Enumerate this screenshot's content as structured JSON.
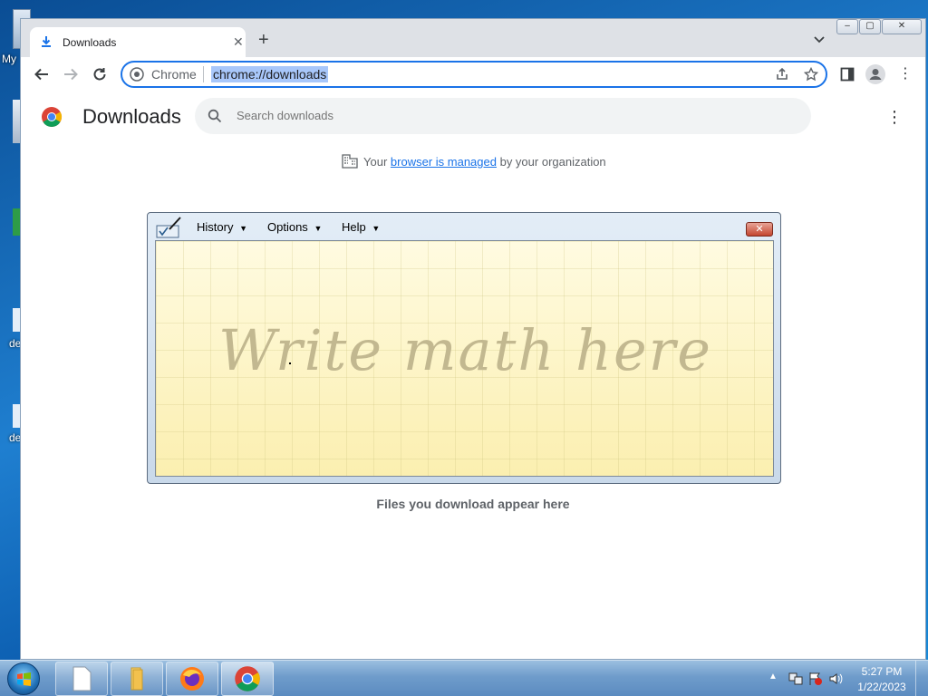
{
  "desktop": {
    "labels": [
      "My",
      "de",
      "de"
    ]
  },
  "browser": {
    "tab": {
      "title": "Downloads"
    },
    "new_tab_label": "+",
    "window_controls": [
      "–",
      "▢",
      "✕"
    ],
    "omnibox": {
      "chip": "Chrome",
      "url": "chrome://downloads"
    }
  },
  "downloads_page": {
    "title": "Downloads",
    "search_placeholder": "Search downloads",
    "managed_prefix": "Your",
    "managed_link": "browser is managed",
    "managed_suffix": "by your organization",
    "empty_message": "Files you download appear here"
  },
  "math_input_panel": {
    "menus": [
      {
        "label": "History"
      },
      {
        "label": "Options"
      },
      {
        "label": "Help"
      }
    ],
    "close_label": "✕",
    "hint": "Write math here"
  },
  "taskbar": {
    "time": "5:27 PM",
    "date": "1/22/2023"
  },
  "colors": {
    "accent": "#1a73e8",
    "pad": "#fdf6c6",
    "hint": "#c2b890"
  }
}
